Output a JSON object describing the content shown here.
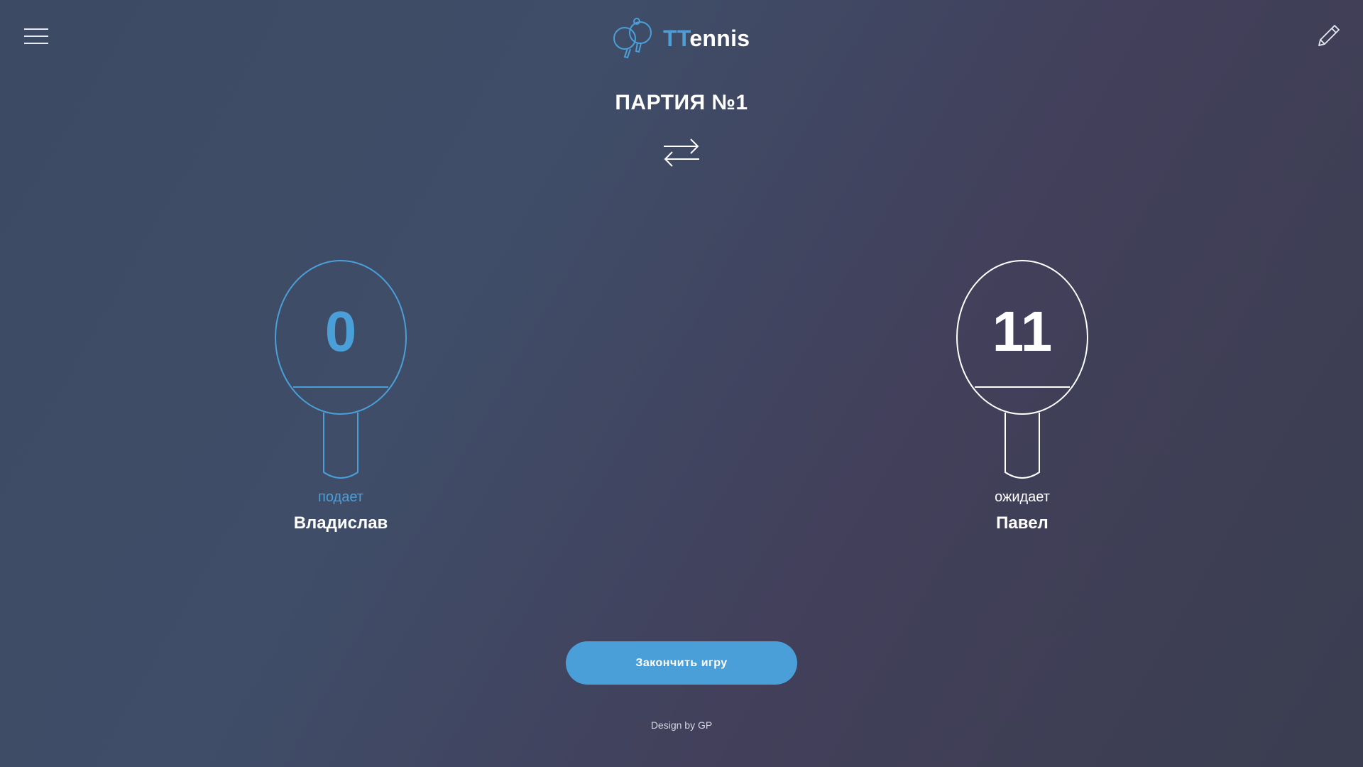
{
  "header": {
    "logo_accent": "TT",
    "logo_rest": "ennis",
    "menu_icon": "hamburger-menu-icon",
    "edit_icon": "pencil-icon"
  },
  "game": {
    "set_title": "ПАРТИЯ №1",
    "swap_icon": "swap-arrows-icon"
  },
  "players": [
    {
      "score": "0",
      "status": "подает",
      "name": "Владислав",
      "color": "#4a9fd9"
    },
    {
      "score": "11",
      "status": "ожидает",
      "name": "Павел",
      "color": "#ffffff"
    }
  ],
  "actions": {
    "end_game_label": "Закончить игру"
  },
  "footer": {
    "credit": "Design by GP"
  },
  "colors": {
    "accent": "#4a9fd9",
    "text": "#ffffff",
    "background": "#3f4a62"
  }
}
